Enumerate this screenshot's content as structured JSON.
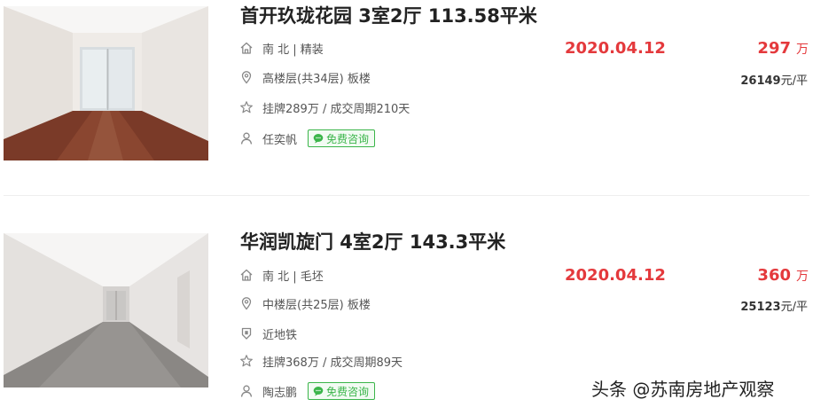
{
  "listings": [
    {
      "title": "首开玖珑花园 3室2厅 113.58平米",
      "orientation_decoration": "南 北 | 精装",
      "floor_info": "高楼层(共34层) 板楼",
      "listing_info": "挂牌289万 / 成交周期210天",
      "agent": "任奕帆",
      "consult_label": "免费咨询",
      "deal_date": "2020.04.12",
      "total_price": "297",
      "price_unit": "万",
      "unit_price": "26149",
      "unit_price_suffix": "元/平"
    },
    {
      "title": "华润凯旋门 4室2厅 143.3平米",
      "orientation_decoration": "南 北 | 毛坯",
      "floor_info": "中楼层(共25层) 板楼",
      "tag": "近地铁",
      "listing_info": "挂牌368万 / 成交周期89天",
      "agent": "陶志鹏",
      "consult_label": "免费咨询",
      "deal_date": "2020.04.12",
      "total_price": "360",
      "price_unit": "万",
      "unit_price": "25123",
      "unit_price_suffix": "元/平"
    }
  ],
  "watermark": "头条 @苏南房地产观察",
  "colors": {
    "price_red": "#e4393c",
    "consult_green": "#3bb54a",
    "info_gray": "#555555",
    "divider": "#eeeeee"
  },
  "icons": {
    "orientation": "house-icon",
    "floor": "location-pin-icon",
    "tag": "shield-icon",
    "listing": "star-icon",
    "agent": "person-icon",
    "consult": "chat-bubble-icon"
  }
}
